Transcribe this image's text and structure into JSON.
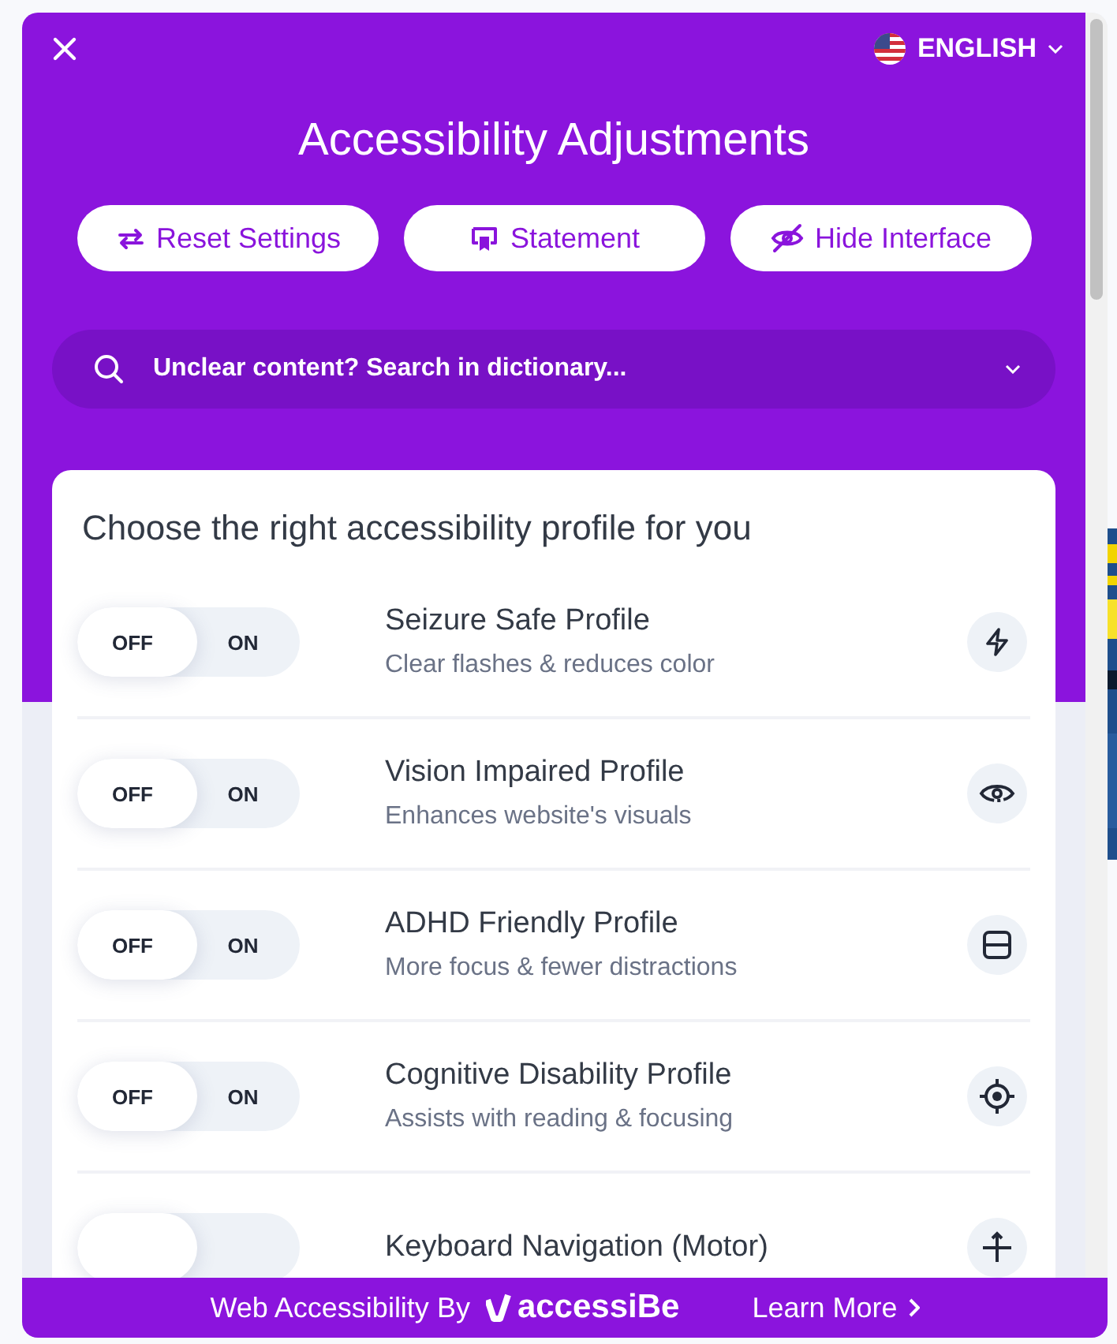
{
  "language": {
    "label": "ENGLISH"
  },
  "title": "Accessibility Adjustments",
  "buttons": [
    {
      "kind": "reset",
      "label": "Reset Settings"
    },
    {
      "kind": "statement",
      "label": "Statement"
    },
    {
      "kind": "hide",
      "label": "Hide Interface"
    }
  ],
  "search": {
    "placeholder": "Unclear content? Search in dictionary..."
  },
  "profiles_title": "Choose the right accessibility profile for you",
  "profiles": [
    {
      "kind": "bolt",
      "name": "Seizure Safe Profile",
      "description": "Clear flashes & reduces color",
      "on": false,
      "off_label": "OFF",
      "on_label": "ON"
    },
    {
      "kind": "eye",
      "name": "Vision Impaired Profile",
      "description": "Enhances website's visuals",
      "on": false,
      "off_label": "OFF",
      "on_label": "ON"
    },
    {
      "kind": "frame",
      "name": "ADHD Friendly Profile",
      "description": "More focus & fewer distractions",
      "on": false,
      "off_label": "OFF",
      "on_label": "ON"
    },
    {
      "kind": "target",
      "name": "Cognitive Disability Profile",
      "description": "Assists with reading & focusing",
      "on": false,
      "off_label": "OFF",
      "on_label": "ON"
    },
    {
      "kind": "arrows",
      "name": "Keyboard Navigation (Motor)",
      "on": false
    }
  ],
  "footer": {
    "text": "Web Accessibility By",
    "brand": "accessiBe",
    "link": "Learn More"
  }
}
